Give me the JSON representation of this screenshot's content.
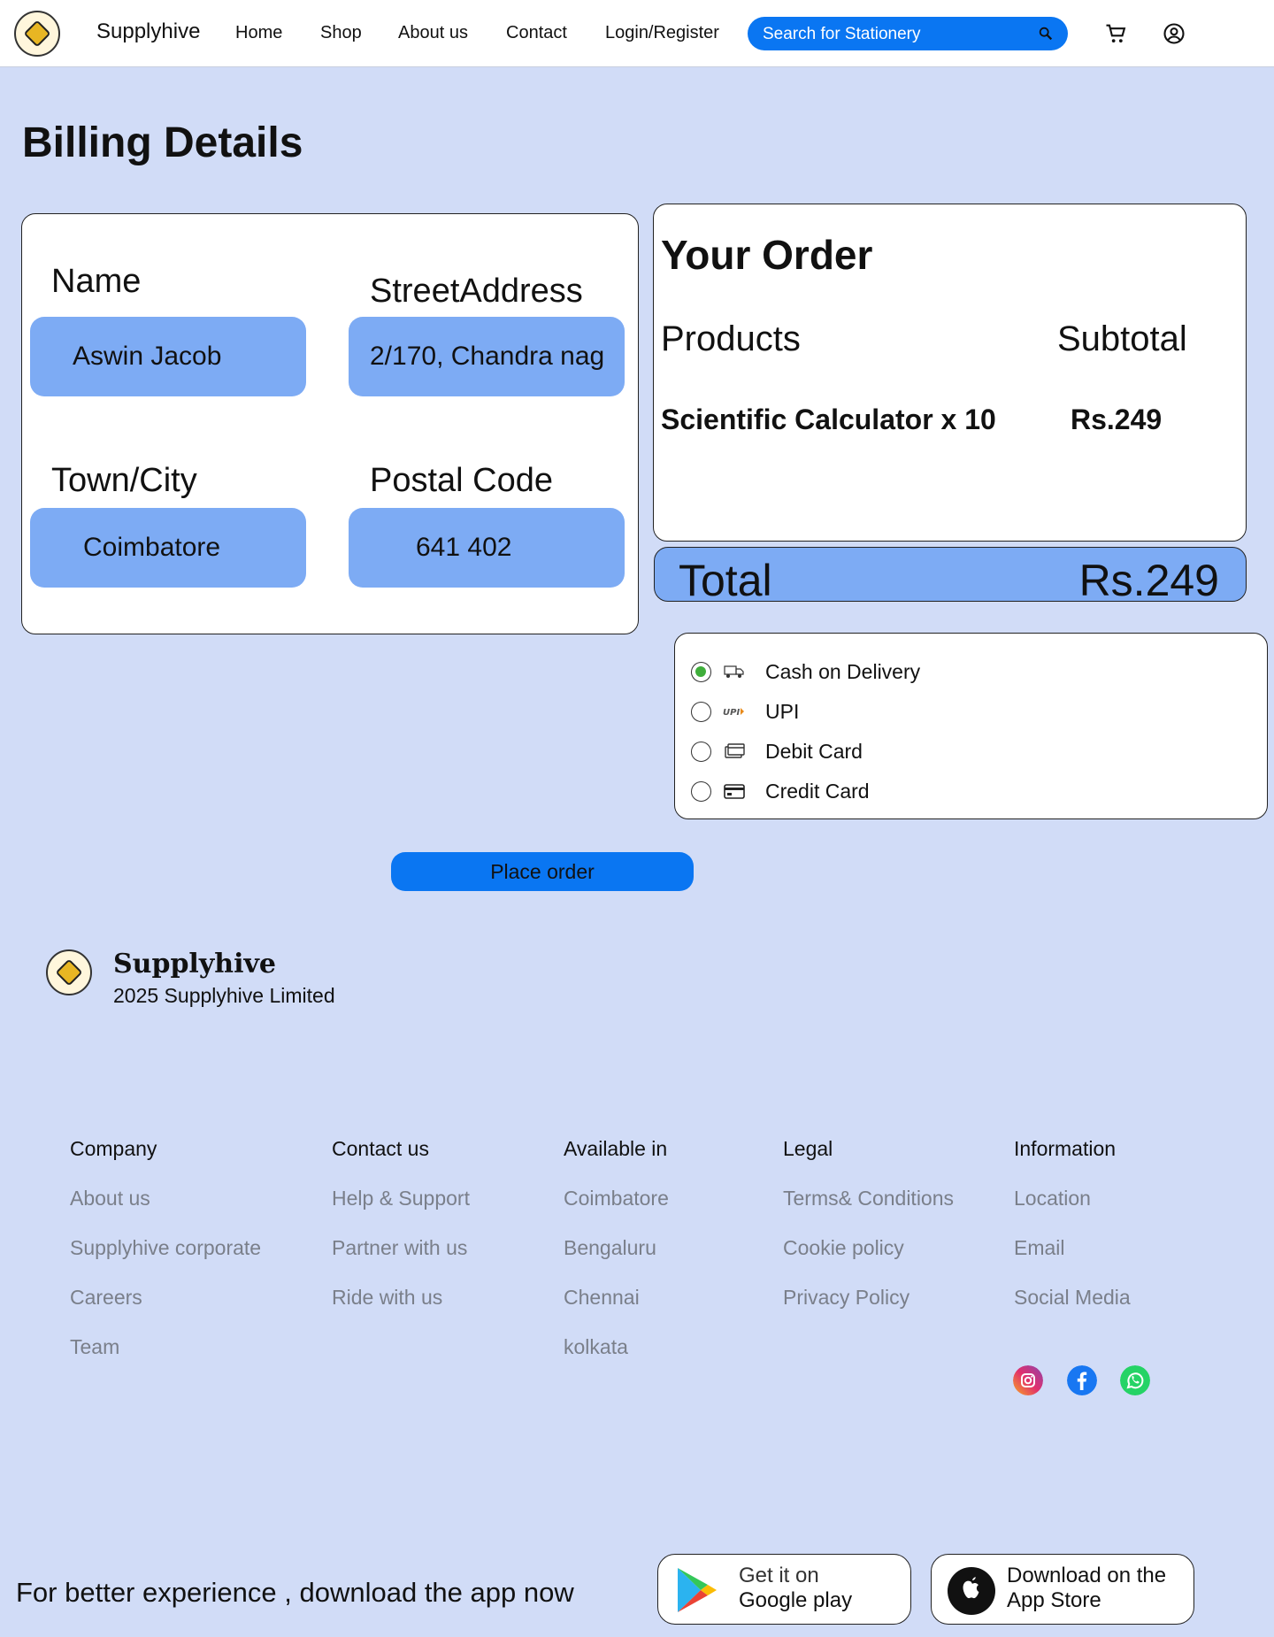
{
  "nav": {
    "brand": "Supplyhive",
    "links": [
      "Home",
      "Shop",
      "About us",
      "Contact",
      "Login/Register"
    ],
    "search_placeholder": "Search for Stationery",
    "accent": "#0a76f2"
  },
  "billing": {
    "title": "Billing Details",
    "fields": [
      {
        "label": "Name",
        "value": "Aswin Jacob"
      },
      {
        "label": "StreetAddress",
        "value": "2/170, Chandra nag"
      },
      {
        "label": "Town/City",
        "value": "Coimbatore"
      },
      {
        "label": "Postal Code",
        "value": "641 402"
      }
    ],
    "field_color": "#7dabf4"
  },
  "order": {
    "title": "Your Order",
    "col_products": "Products",
    "col_subtotal": "Subtotal",
    "item_name": "Scientific Calculator x 10",
    "item_price": "Rs.249",
    "total_label": "Total",
    "total_value": "Rs.249"
  },
  "payment": {
    "options": [
      {
        "label": "Cash on Delivery",
        "icon": "truck-icon",
        "selected": true
      },
      {
        "label": "UPI",
        "icon": "upi-icon",
        "selected": false
      },
      {
        "label": "Debit Card",
        "icon": "debit-card-icon",
        "selected": false
      },
      {
        "label": "Credit Card",
        "icon": "credit-card-icon",
        "selected": false
      }
    ],
    "selected_color": "#3fae3b"
  },
  "place_order": "Place order",
  "footer": {
    "brand": "Supplyhive",
    "copyright": "2025 Supplyhive Limited",
    "columns": [
      {
        "head": "Company",
        "links": [
          "About us",
          "Supplyhive corporate",
          "Careers",
          "Team"
        ]
      },
      {
        "head": "Contact us",
        "links": [
          "Help & Support",
          "Partner with us",
          "Ride with us"
        ]
      },
      {
        "head": "Available in",
        "links": [
          "Coimbatore",
          "Bengaluru",
          "Chennai",
          "kolkata"
        ]
      },
      {
        "head": "Legal",
        "links": [
          "Terms& Conditions",
          "Cookie policy",
          "Privacy Policy"
        ]
      },
      {
        "head": "Information",
        "links": [
          "Location",
          "Email",
          "Social Media"
        ]
      }
    ],
    "social": [
      "instagram-icon",
      "facebook-icon",
      "whatsapp-icon"
    ],
    "cta": "For better experience , download the app now",
    "google_line1": "Get it on",
    "google_line2": "Google play",
    "apple_line1": "Download on the",
    "apple_line2": "App Store"
  }
}
